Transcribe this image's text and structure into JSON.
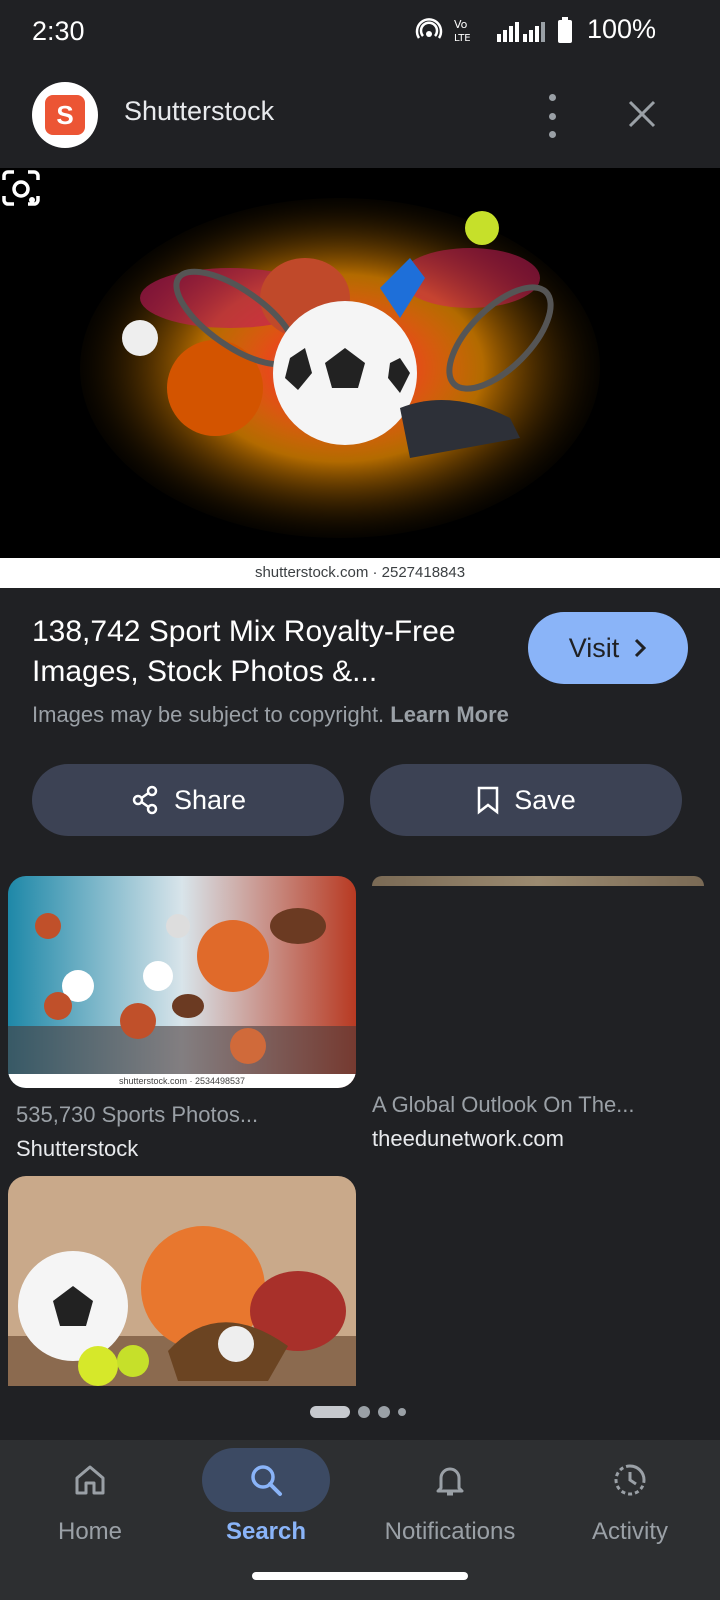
{
  "status": {
    "time": "2:30",
    "battery": "100%"
  },
  "header": {
    "site_name": "Shutterstock",
    "logo_letter": "S"
  },
  "hero": {
    "credit": "shutterstock.com · 2527418843"
  },
  "result": {
    "title": "138,742 Sport Mix Royalty-Free Images, Stock Photos &...",
    "visit_label": "Visit",
    "copyright_text": "Images may be subject to copyright.",
    "learn_more": "Learn More"
  },
  "actions": {
    "share_label": "Share",
    "save_label": "Save"
  },
  "related": [
    {
      "title": "535,730 Sports Photos...",
      "source": "Shutterstock",
      "credit": "shutterstock.com · 2534498537"
    },
    {
      "title": "A Global Outlook On The...",
      "source": "theedunetwork.com"
    }
  ],
  "nav": {
    "items": [
      "Home",
      "Search",
      "Notifications",
      "Activity"
    ],
    "active": "Search"
  },
  "colors": {
    "accent": "#8ab4f8",
    "background": "#202124",
    "button": "#3c4254",
    "brand": "#ec5534"
  }
}
